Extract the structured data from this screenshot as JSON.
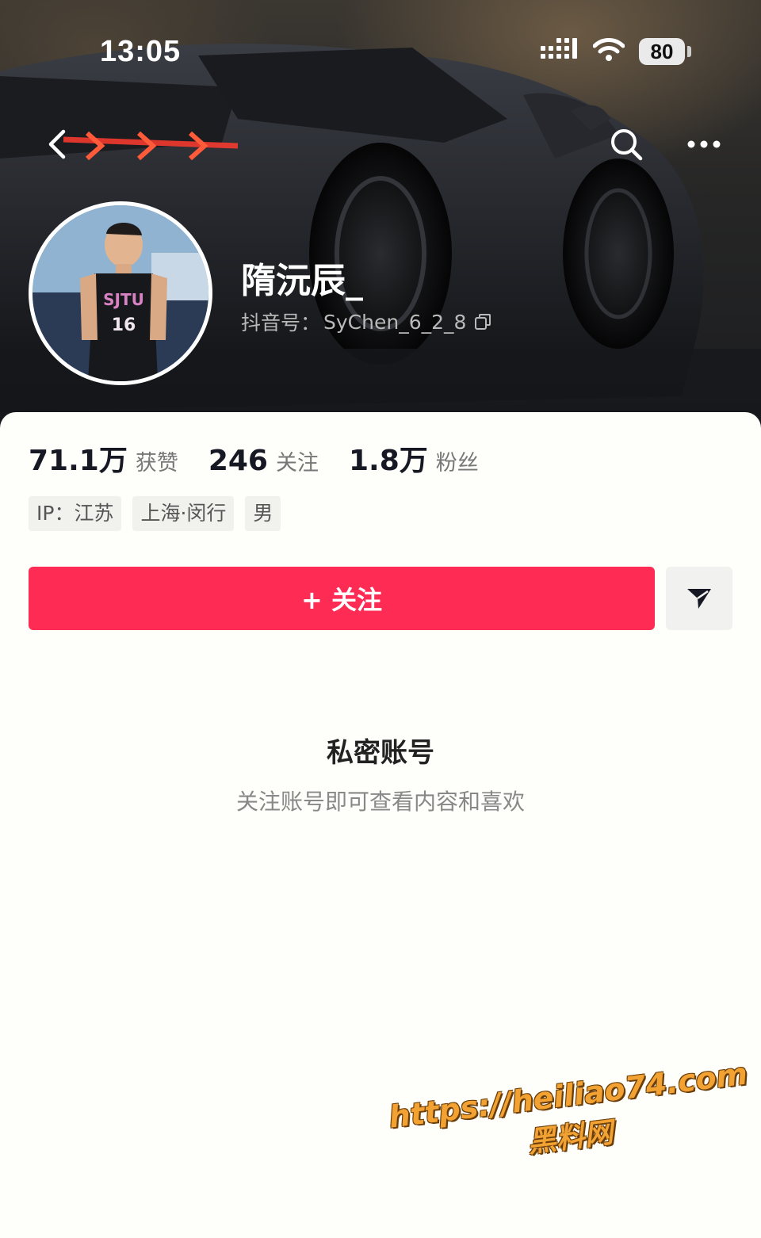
{
  "status_bar": {
    "time": "13:05",
    "battery": "80"
  },
  "icons": {
    "back": "chevron-left-icon",
    "search": "search-icon",
    "more": "more-dots-icon",
    "copy": "copy-icon",
    "share": "share-arrow-icon",
    "follow_plus": "plus-icon"
  },
  "profile": {
    "name": "隋沅辰_",
    "id_label": "抖音号：",
    "id_value": "SyChen_6_2_8",
    "avatar_jersey": "SJTU",
    "avatar_number": "16"
  },
  "stats": [
    {
      "value": "71.1万",
      "label": "获赞"
    },
    {
      "value": "246",
      "label": "关注"
    },
    {
      "value": "1.8万",
      "label": "粉丝"
    }
  ],
  "tags": [
    "IP：江苏",
    "上海·闵行",
    "男"
  ],
  "actions": {
    "follow_label": "+ 关注"
  },
  "private": {
    "title": "私密账号",
    "subtitle": "关注账号即可查看内容和喜欢"
  },
  "watermark": {
    "url": "https://heiliao74.com",
    "name": "黑料网"
  },
  "colors": {
    "accent": "#fe2c55",
    "background": "#fefefa"
  }
}
